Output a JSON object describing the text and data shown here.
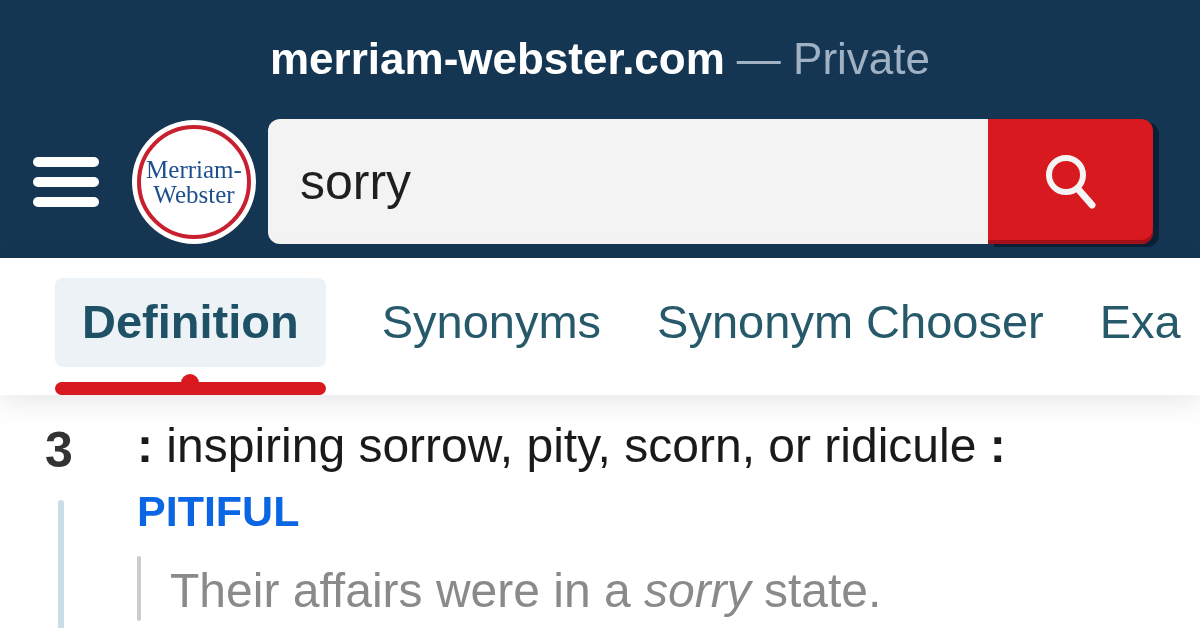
{
  "browser_bar": {
    "domain": "merriam-webster.com",
    "mode": "— Private"
  },
  "header": {
    "logo": {
      "lines": [
        "Merriam-",
        "Webster"
      ]
    },
    "search": {
      "value": "sorry"
    }
  },
  "tabs": [
    {
      "label": "Definition",
      "selected": true
    },
    {
      "label": "Synonyms",
      "selected": false
    },
    {
      "label": "Synonym Chooser",
      "selected": false
    },
    {
      "label": "Exa",
      "selected": false
    }
  ],
  "entry": {
    "sense_number": "3",
    "definition": "**:** inspiring sorrow, pity, scorn, or ridicule **:**",
    "synonym": "PITIFUL",
    "example": "Their affairs were in a *sorry* state."
  }
}
